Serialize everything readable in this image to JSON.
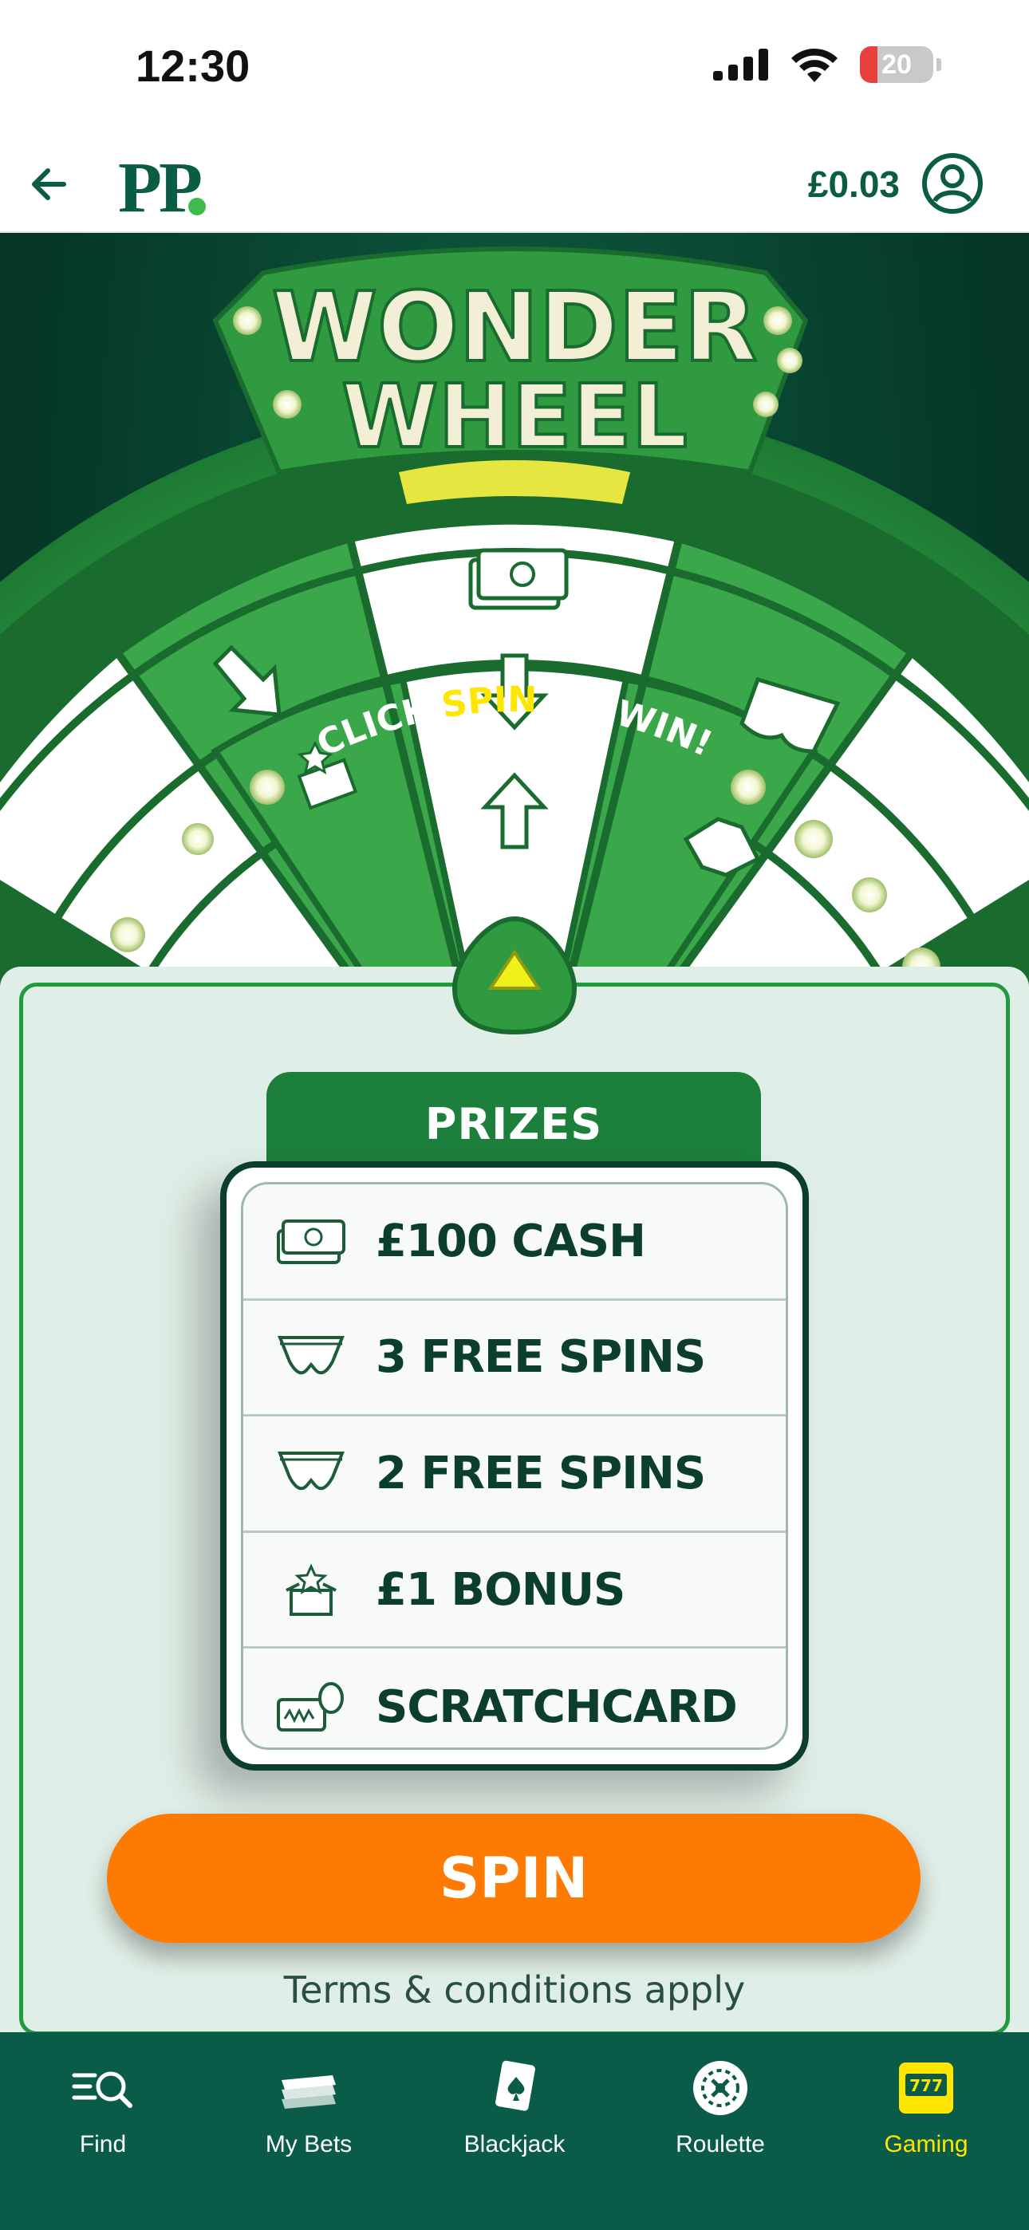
{
  "status_bar": {
    "time": "12:30",
    "battery": "20"
  },
  "header": {
    "logo": "PP",
    "balance": "£0.03"
  },
  "game": {
    "title_line1": "WONDER",
    "title_line2": "WHEEL",
    "subtitle_pre": "CLICK ",
    "subtitle_highlight": "SPIN",
    "subtitle_post": " TO WIN!",
    "prizes_header": "PRIZES",
    "prizes": [
      {
        "label": "£100 CASH",
        "icon": "cash-icon"
      },
      {
        "label": "3 FREE SPINS",
        "icon": "pants-icon"
      },
      {
        "label": "2 FREE SPINS",
        "icon": "pants-icon"
      },
      {
        "label": "£1 BONUS",
        "icon": "gift-box-icon"
      },
      {
        "label": "SCRATCHCARD",
        "icon": "scratchcard-icon"
      }
    ],
    "spin_label": "SPIN",
    "terms": "Terms & conditions apply"
  },
  "nav": {
    "items": [
      {
        "label": "Find",
        "icon": "find-icon"
      },
      {
        "label": "My Bets",
        "icon": "bets-icon"
      },
      {
        "label": "Blackjack",
        "icon": "blackjack-icon"
      },
      {
        "label": "Roulette",
        "icon": "roulette-icon"
      },
      {
        "label": "Gaming",
        "icon": "slot-machine-icon",
        "active": true
      }
    ]
  },
  "colors": {
    "brand_green": "#0b5c45",
    "wheel_green": "#3aa84a",
    "spin_orange": "#ff7a00",
    "nav_bg": "#0a5c49",
    "active_yellow": "#ffe600"
  }
}
